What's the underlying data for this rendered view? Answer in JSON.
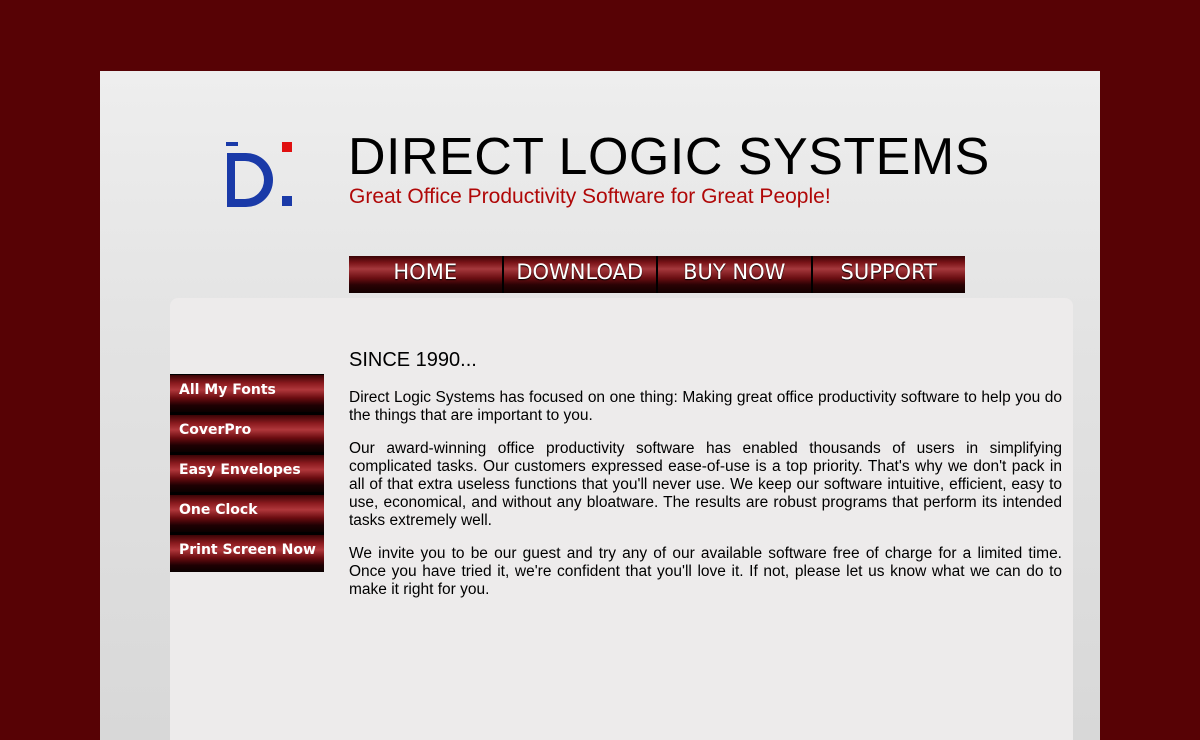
{
  "header": {
    "title": "DIRECT LOGIC SYSTEMS",
    "tagline": "Great Office Productivity Software for Great People!",
    "colors": {
      "logo_blue": "#1a3aa8",
      "logo_red": "#e01010",
      "tagline": "#b00808",
      "background": "#570205"
    }
  },
  "topnav": {
    "items": [
      {
        "label": "HOME"
      },
      {
        "label": "DOWNLOAD"
      },
      {
        "label": "BUY NOW"
      },
      {
        "label": "SUPPORT"
      }
    ]
  },
  "sidenav": {
    "items": [
      {
        "label": "All My Fonts"
      },
      {
        "label": "CoverPro"
      },
      {
        "label": "Easy Envelopes"
      },
      {
        "label": "One Clock"
      },
      {
        "label": "Print Screen Now"
      }
    ]
  },
  "main": {
    "heading": "SINCE 1990...",
    "paragraphs": [
      "Direct Logic Systems has focused on one thing: Making great office productivity software to help you do the things that are important to you.",
      "Our award-winning office productivity software has enabled thousands of users in simplifying complicated tasks. Our customers expressed ease-of-use is a top priority. That's why we don't pack in all of that extra useless functions that you'll never use. We keep our software intuitive, efficient, easy to use, economical, and without any bloatware. The results are robust programs that perform its intended tasks extremely well.",
      "We invite you to be our guest and try any of our available software free of charge for a limited time. Once you have tried it, we're confident that you'll love it. If not, please let us know what we can do to make it right for you."
    ]
  }
}
